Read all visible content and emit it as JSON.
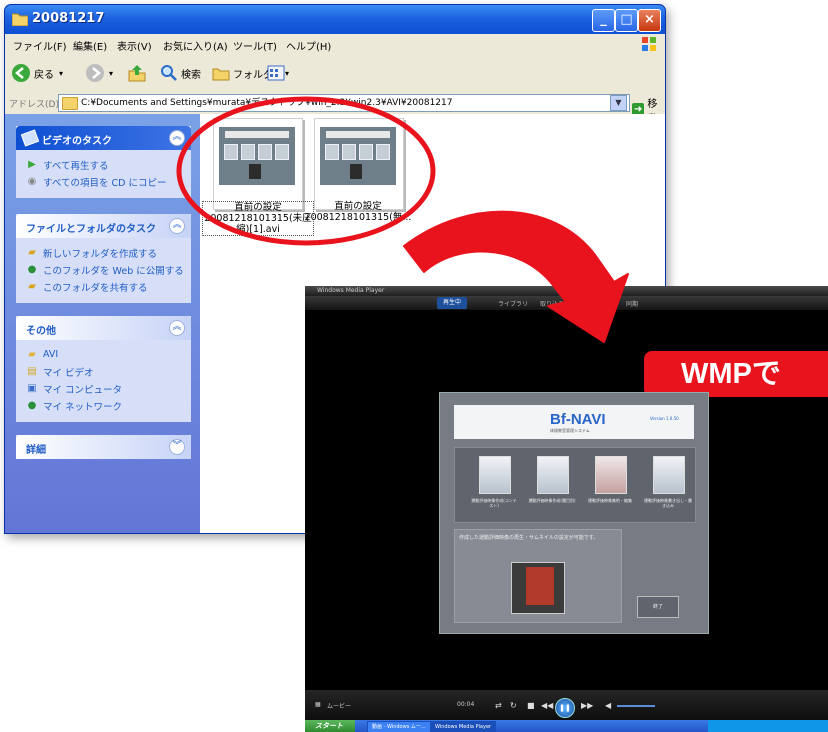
{
  "explorer": {
    "title": "20081217",
    "menu": [
      "ファイル(F)",
      "編集(E)",
      "表示(V)",
      "お気に入り(A)",
      "ツール(T)",
      "ヘルプ(H)"
    ],
    "toolbar": {
      "back": "戻る",
      "search": "検索",
      "folders": "フォルダ"
    },
    "address": {
      "label": "アドレス(D)",
      "path": "C:¥Documents and Settings¥murata¥デスクトップ¥win_2.3¥win2.3¥AVI¥20081217",
      "go": "移動"
    },
    "panels": [
      {
        "title": "ビデオのタスク",
        "items": [
          "すべて再生する",
          "すべての項目を CD にコピー"
        ]
      },
      {
        "title": "ファイルとフォルダのタスク",
        "items": [
          "新しいフォルダを作成する",
          "このフォルダを Web に公開する",
          "このフォルダを共有する"
        ]
      },
      {
        "title": "その他",
        "items": [
          "AVI",
          "マイ ビデオ",
          "マイ コンピュータ",
          "マイ ネットワーク"
        ]
      },
      {
        "title": "詳細",
        "items": []
      }
    ],
    "files": [
      {
        "line1": "直前の設定",
        "line2": "20081218101315(未圧",
        "line3": "縮)[1].avi",
        "selected": true
      },
      {
        "line1": "直前の設定",
        "line2": "20081218101315(無...",
        "line3": "",
        "selected": false
      }
    ]
  },
  "wmp": {
    "title": "Windows Media Player",
    "tabs": [
      "再生中",
      "ライブラリ",
      "取り込み",
      "書き込み",
      "同期"
    ],
    "callout": "WMPで",
    "app": {
      "logo": "Bf-NAVI",
      "logo_sub": "体操教室管理システム",
      "version": "Version 1.0.50",
      "menu": [
        "運動評価映像作成(コンテスト)",
        "運動評価映像作成(種目別)",
        "運動評価映像集約・編集",
        "運動評価映像書き出し・書き込み"
      ],
      "info": "作成した運動評価映像の再生・サムネイルの設定が可能です。",
      "end": "終了"
    },
    "controls": {
      "time": "00:04",
      "status": "ムービー"
    },
    "taskbar": {
      "start": "スタート",
      "items": [
        "動画 - Windows ムー...",
        "Windows Media Player"
      ]
    }
  },
  "colors": {
    "xp_blue": "#0d4fd2",
    "callout_red": "#e8131d",
    "ring_red": "#e8131d"
  }
}
